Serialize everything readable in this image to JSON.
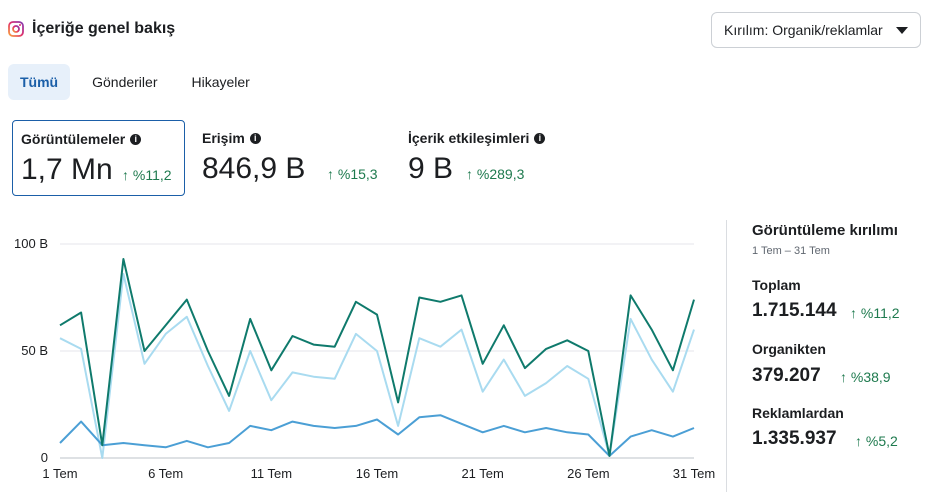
{
  "header": {
    "title": "İçeriğe genel bakış",
    "breakdown_label": "Kırılım: Organik/reklamlar"
  },
  "tabs": [
    {
      "label": "Tümü",
      "active": true
    },
    {
      "label": "Gönderiler",
      "active": false
    },
    {
      "label": "Hikayeler",
      "active": false
    }
  ],
  "metrics": [
    {
      "label": "Görüntülemeler",
      "value": "1,7 Mn",
      "delta": "↑ %11,2",
      "selected": true
    },
    {
      "label": "Erişim",
      "value": "846,9 B",
      "delta": "↑ %15,3",
      "selected": false
    },
    {
      "label": "İçerik etkileşimleri",
      "value": "9 B",
      "delta": "↑ %289,3",
      "selected": false
    }
  ],
  "side": {
    "title": "Görüntüleme kırılımı",
    "range": "1 Tem – 31 Tem",
    "total_label": "Toplam",
    "total_value": "1.715.144",
    "total_delta": "↑ %11,2",
    "organic_label": "Organikten",
    "organic_value": "379.207",
    "organic_delta": "↑ %38,9",
    "ads_label": "Reklamlardan",
    "ads_value": "1.335.937",
    "ads_delta": "↑ %5,2"
  },
  "colors": {
    "total": "#0f7a6c",
    "ads": "#a9dbf0",
    "organic": "#4b9fd5",
    "positive": "#1e7a4e",
    "accent": "#1b5fa8"
  },
  "chart_data": {
    "type": "line",
    "x": [
      1,
      2,
      3,
      4,
      5,
      6,
      7,
      8,
      9,
      10,
      11,
      12,
      13,
      14,
      15,
      16,
      17,
      18,
      19,
      20,
      21,
      22,
      23,
      24,
      25,
      26,
      27,
      28,
      29,
      30,
      31
    ],
    "xticks": [
      "1 Tem",
      "6 Tem",
      "11 Tem",
      "16 Tem",
      "21 Tem",
      "26 Tem",
      "31 Tem"
    ],
    "yticks": [
      "0",
      "50 B",
      "100 B"
    ],
    "ylim": [
      0,
      100000
    ],
    "grid": true,
    "series": [
      {
        "key": "total",
        "values": [
          62000,
          68000,
          6000,
          93000,
          50000,
          62000,
          74000,
          50000,
          29000,
          65000,
          41000,
          57000,
          53000,
          52000,
          73000,
          67000,
          26000,
          75000,
          73000,
          76000,
          44000,
          62000,
          42000,
          51000,
          55000,
          50000,
          1000,
          76000,
          60000,
          41000,
          74000
        ]
      },
      {
        "key": "ads",
        "values": [
          56000,
          51000,
          0,
          86000,
          44000,
          58000,
          66000,
          43000,
          22000,
          50000,
          27000,
          40000,
          38000,
          37000,
          58000,
          50000,
          15000,
          56000,
          52000,
          60000,
          31000,
          46000,
          29000,
          35000,
          43000,
          37000,
          1000,
          65000,
          46000,
          31000,
          60000
        ]
      },
      {
        "key": "organic",
        "values": [
          7000,
          17000,
          6000,
          7000,
          6000,
          5000,
          8000,
          5000,
          7000,
          15000,
          13000,
          17000,
          15000,
          14000,
          15000,
          18000,
          11000,
          19000,
          20000,
          16000,
          12000,
          15000,
          12000,
          14000,
          12000,
          11000,
          1000,
          10000,
          13000,
          10000,
          14000
        ]
      }
    ]
  }
}
